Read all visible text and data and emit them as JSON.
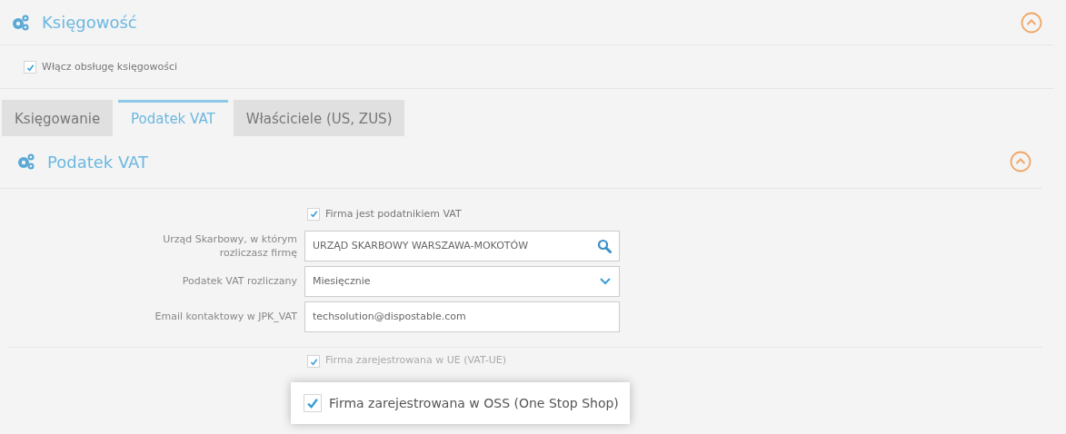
{
  "section": {
    "title": "Księgowość",
    "expanded": true
  },
  "enable_accounting": {
    "label": "Włącz obsługę księgowości",
    "checked": true
  },
  "tabs": [
    {
      "label": "Księgowanie",
      "selected": false
    },
    {
      "label": "Podatek VAT",
      "selected": true
    },
    {
      "label": "Właściciele (US, ZUS)",
      "selected": false
    }
  ],
  "subsection": {
    "title": "Podatek VAT",
    "expanded": true
  },
  "vat_payer": {
    "label": "Firma jest podatnikiem VAT",
    "checked": true
  },
  "fields": [
    {
      "kind": "search",
      "label": "Urząd Skarbowy, w którym rozliczasz firmę",
      "value": "URZĄD SKARBOWY WARSZAWA-MOKOTÓW"
    },
    {
      "kind": "select",
      "label": "Podatek VAT rozliczany",
      "value": "Miesięcznie"
    },
    {
      "kind": "text",
      "label": "Email kontaktowy w JPK_VAT",
      "value": "techsolution@dispostable.com"
    }
  ],
  "eu_registered": {
    "label": "Firma zarejestrowana w UE (VAT-UE)",
    "checked": true
  },
  "highlight": {
    "label": "Firma zarejestrowana w OSS (One Stop Shop)",
    "checked": true
  }
}
